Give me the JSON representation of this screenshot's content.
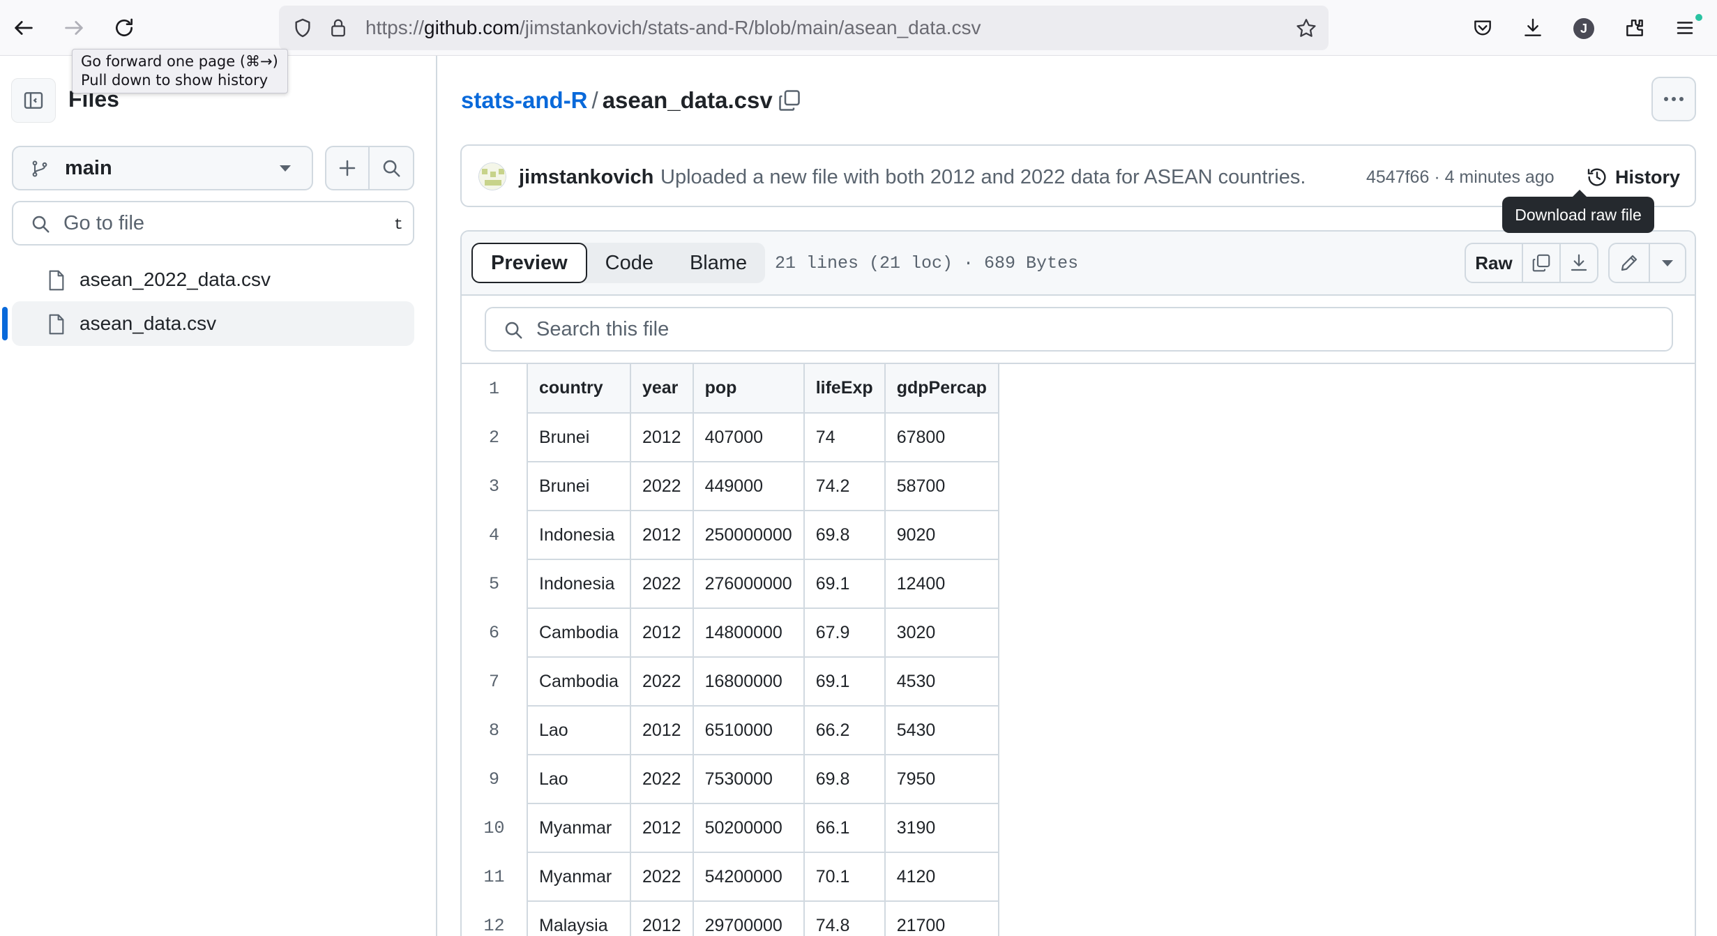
{
  "browser": {
    "url_prefix": "https://",
    "url_host": "github.com",
    "url_path": "/jimstankovich/stats-and-R/blob/main/asean_data.csv",
    "profile_initial": "J",
    "forward_tooltip_line1": "Go forward one page (⌘→)",
    "forward_tooltip_line2": "Pull down to show history"
  },
  "sidebar": {
    "title": "Files",
    "branch": "main",
    "goto_placeholder": "Go to file",
    "goto_shortcut": "t",
    "files": [
      {
        "name": "asean_2022_data.csv",
        "active": false
      },
      {
        "name": "asean_data.csv",
        "active": true
      }
    ]
  },
  "breadcrumb": {
    "repo": "stats-and-R",
    "separator": "/",
    "file": "asean_data.csv"
  },
  "commit": {
    "author": "jimstankovich",
    "message": "Uploaded a new file with both 2012 and 2022 data for ASEAN countries.",
    "sha_time": "4547f66 · 4 minutes ago",
    "history_label": "History"
  },
  "file_view": {
    "tabs": [
      {
        "label": "Preview",
        "selected": true
      },
      {
        "label": "Code",
        "selected": false
      },
      {
        "label": "Blame",
        "selected": false
      }
    ],
    "meta": "21 lines (21 loc) · 689 Bytes",
    "raw_label": "Raw",
    "raw_tooltip": "Download raw file",
    "search_placeholder": "Search this file"
  },
  "table": {
    "rows": [
      {
        "ln": "1",
        "cells": [
          "country",
          "year",
          "pop",
          "lifeExp",
          "gdpPercap"
        ]
      },
      {
        "ln": "2",
        "cells": [
          "Brunei",
          "2012",
          "407000",
          "74",
          "67800"
        ]
      },
      {
        "ln": "3",
        "cells": [
          "Brunei",
          "2022",
          "449000",
          "74.2",
          "58700"
        ]
      },
      {
        "ln": "4",
        "cells": [
          "Indonesia",
          "2012",
          "250000000",
          "69.8",
          "9020"
        ]
      },
      {
        "ln": "5",
        "cells": [
          "Indonesia",
          "2022",
          "276000000",
          "69.1",
          "12400"
        ]
      },
      {
        "ln": "6",
        "cells": [
          "Cambodia",
          "2012",
          "14800000",
          "67.9",
          "3020"
        ]
      },
      {
        "ln": "7",
        "cells": [
          "Cambodia",
          "2022",
          "16800000",
          "69.1",
          "4530"
        ]
      },
      {
        "ln": "8",
        "cells": [
          "Lao",
          "2012",
          "6510000",
          "66.2",
          "5430"
        ]
      },
      {
        "ln": "9",
        "cells": [
          "Lao",
          "2022",
          "7530000",
          "69.8",
          "7950"
        ]
      },
      {
        "ln": "10",
        "cells": [
          "Myanmar",
          "2012",
          "50200000",
          "66.1",
          "3190"
        ]
      },
      {
        "ln": "11",
        "cells": [
          "Myanmar",
          "2022",
          "54200000",
          "70.1",
          "4120"
        ]
      },
      {
        "ln": "12",
        "cells": [
          "Malaysia",
          "2012",
          "29700000",
          "74.8",
          "21700"
        ]
      }
    ]
  },
  "colors": {
    "link": "#0969da",
    "border": "#d1d9e0",
    "muted": "#59636e",
    "tooltip_bg": "#25292e"
  },
  "icons": [
    "back-arrow-icon",
    "forward-arrow-icon",
    "reload-icon",
    "shield-icon",
    "lock-icon",
    "star-icon",
    "pocket-icon",
    "download-icon",
    "extensions-icon",
    "menu-icon",
    "sidebar-toggle-icon",
    "branch-icon",
    "plus-icon",
    "search-icon",
    "file-icon",
    "copy-icon",
    "kebab-icon",
    "history-icon",
    "pencil-icon",
    "chevron-down-icon"
  ]
}
